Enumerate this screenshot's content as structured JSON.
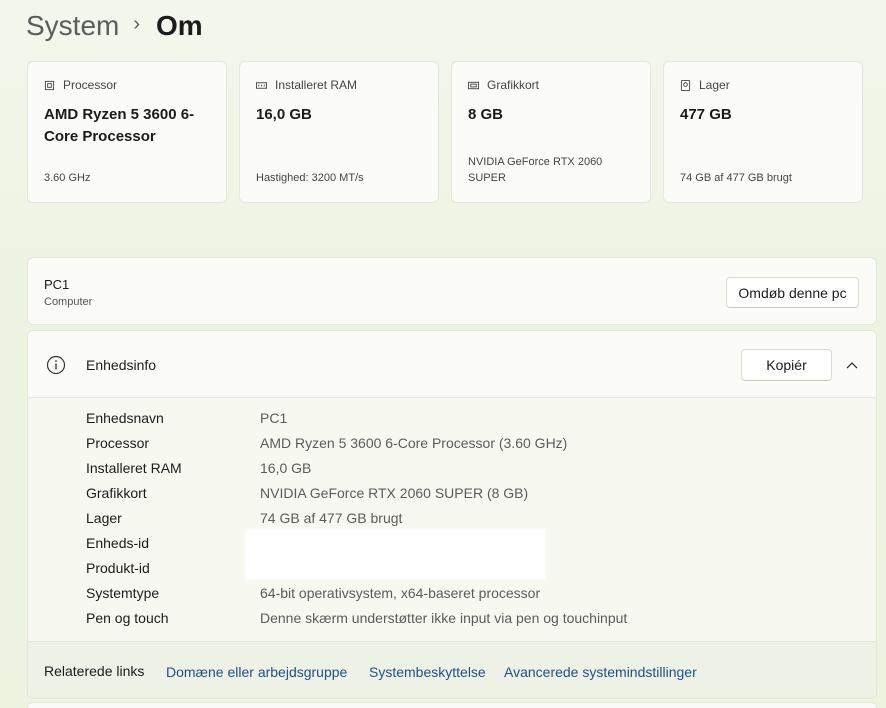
{
  "breadcrumb": {
    "parent": "System",
    "separator": "›",
    "current": "Om"
  },
  "cards": [
    {
      "icon": "processor-icon",
      "label": "Processor",
      "value": "AMD Ryzen 5 3600 6-Core Processor",
      "sub": "3.60 GHz"
    },
    {
      "icon": "ram-icon",
      "label": "Installeret RAM",
      "value": "16,0 GB",
      "sub": "Hastighed: 3200 MT/s"
    },
    {
      "icon": "graphics-card-icon",
      "label": "Grafikkort",
      "value": "8 GB",
      "sub": "NVIDIA GeForce RTX 2060 SUPER"
    },
    {
      "icon": "storage-icon",
      "label": "Lager",
      "value": "477 GB",
      "sub": "74 GB af 477 GB brugt"
    }
  ],
  "pc": {
    "name": "PC1",
    "type": "Computer",
    "rename_label": "Omdøb denne pc"
  },
  "device_info": {
    "title": "Enhedsinfo",
    "copy_label": "Kopiér",
    "rows": [
      {
        "key": "Enhedsnavn",
        "value": "PC1"
      },
      {
        "key": "Processor",
        "value": "AMD Ryzen 5 3600 6-Core Processor (3.60 GHz)"
      },
      {
        "key": "Installeret RAM",
        "value": "16,0 GB"
      },
      {
        "key": "Grafikkort",
        "value": "NVIDIA GeForce RTX 2060 SUPER (8 GB)"
      },
      {
        "key": "Lager",
        "value": "74 GB af 477 GB brugt"
      },
      {
        "key": "Enheds-id",
        "value": ""
      },
      {
        "key": "Produkt-id",
        "value": ""
      },
      {
        "key": "Systemtype",
        "value": "64-bit operativsystem, x64-baseret processor"
      },
      {
        "key": "Pen og touch",
        "value": "Denne skærm understøtter ikke input via pen og touchinput"
      }
    ]
  },
  "related": {
    "label": "Relaterede links",
    "links": [
      "Domæne eller arbejdsgruppe",
      "Systembeskyttelse",
      "Avancerede systemindstillinger"
    ]
  },
  "colors": {
    "link": "#1f4f8a",
    "background": "#eef4e3",
    "card": "#fbfbf8"
  }
}
